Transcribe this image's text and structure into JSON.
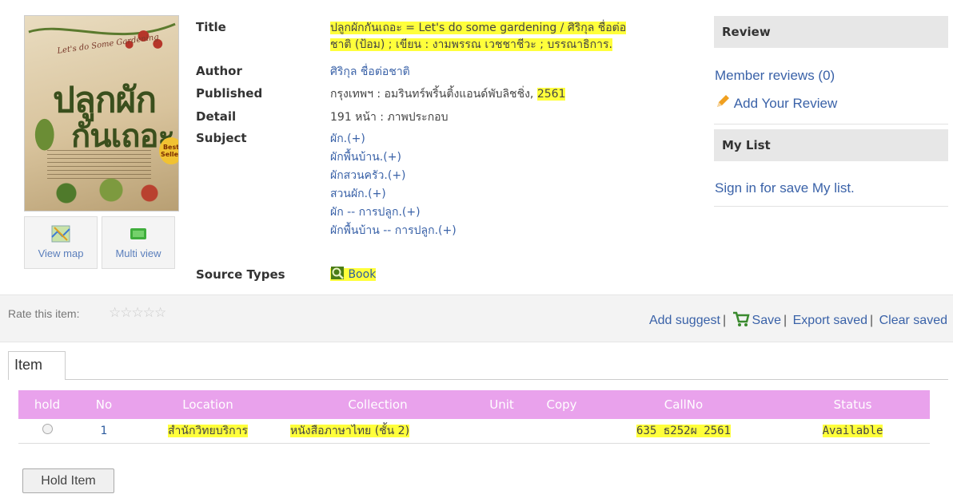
{
  "cover": {
    "subtitle": "Let's do Some Gardening",
    "title_line1": "ปลูกผัก",
    "title_line2": "กันเถอะ",
    "badge": "Best Seller"
  },
  "thumbs": {
    "map_label": "View map",
    "multi_label": "Multi view"
  },
  "metadata": {
    "labels": {
      "title": "Title",
      "author": "Author",
      "published": "Published",
      "detail": "Detail",
      "subject": "Subject",
      "source_types": "Source Types"
    },
    "title_line1": "ปลูกผักกันเถอะ = Let's do some gardening / ศิริกุล ชื่อต่อ",
    "title_line2": "ชาติ (ป้อม) ; เขียน : งามพรรณ เวชชาชีวะ ; บรรณาธิการ.",
    "author": "ศิริกุล ชื่อต่อชาติ",
    "published_place": "กรุงเทพฯ : อมรินทร์พริ้นติ้งแอนด์พับลิชชิ่ง,",
    "published_year": "2561",
    "detail": "191 หน้า : ภาพประกอบ",
    "subjects": [
      "ผัก.(+)",
      "ผักพื้นบ้าน.(+)",
      "ผักสวนครัว.(+)",
      "สวนผัก.(+)",
      "ผัก -- การปลูก.(+)",
      "ผักพื้นบ้าน -- การปลูก.(+)"
    ],
    "source_type": "Book"
  },
  "sidebar": {
    "review_heading": "Review",
    "member_reviews": "Member reviews (0)",
    "add_review": "Add Your Review",
    "mylist_heading": "My List",
    "signin": "Sign in for save My list."
  },
  "toolbar": {
    "rate_label": "Rate this item:",
    "add_suggest": "Add suggest",
    "save": "Save",
    "export_saved": "Export saved",
    "clear_saved": "Clear saved"
  },
  "tab": {
    "label": "Item"
  },
  "table": {
    "headers": [
      "hold",
      "No",
      "Location",
      "Collection",
      "Unit",
      "Copy",
      "CallNo",
      "Status"
    ],
    "row": {
      "no": "1",
      "location": "สำนักวิทยบริการ",
      "collection": "หนังสือภาษาไทย (ชั้น 2)",
      "unit": "",
      "copy": "",
      "callno": "635 ธ252ผ 2561",
      "status": "Available"
    }
  },
  "hold_button": "Hold Item",
  "colors": {
    "link": "#3a62a8",
    "table_header": "#e9a2ec",
    "highlight": "#ffff3b"
  }
}
